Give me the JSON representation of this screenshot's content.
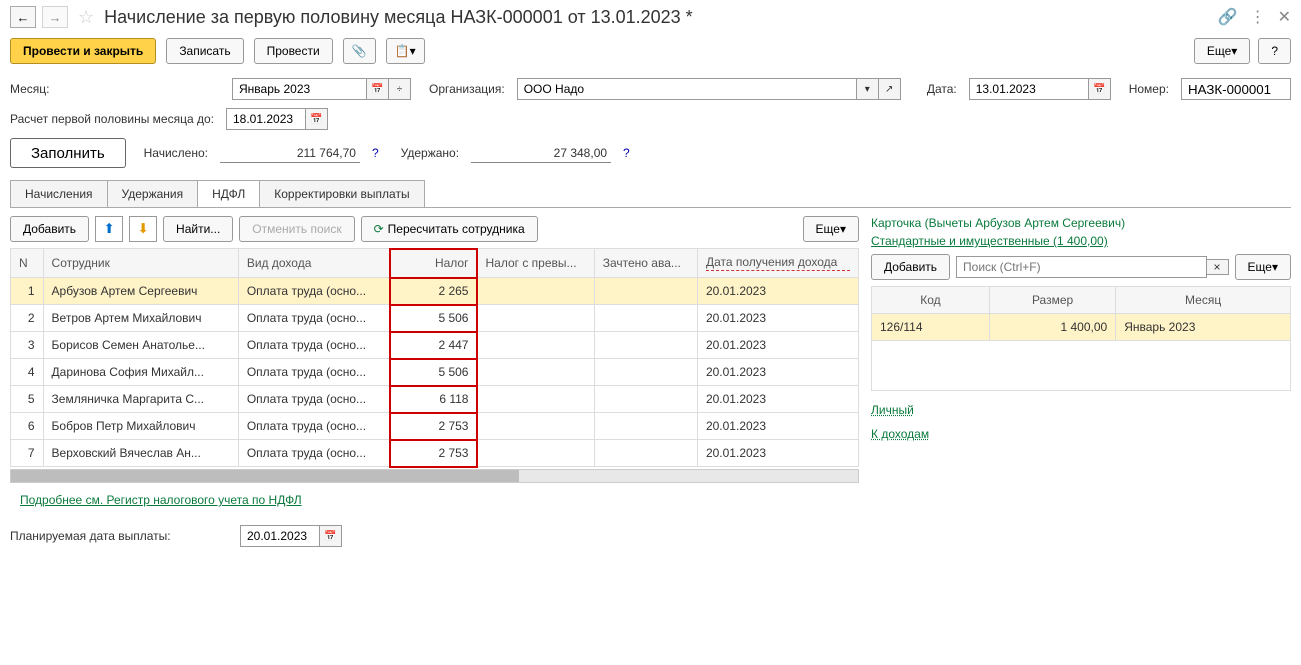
{
  "title": "Начисление за первую половину месяца НАЗК-000001 от 13.01.2023 *",
  "toolbar": {
    "post_close": "Провести и закрыть",
    "write": "Записать",
    "post": "Провести",
    "more": "Еще",
    "help": "?"
  },
  "form": {
    "month_label": "Месяц:",
    "month_value": "Январь 2023",
    "org_label": "Организация:",
    "org_value": "ООО Надо",
    "date_label": "Дата:",
    "date_value": "13.01.2023",
    "number_label": "Номер:",
    "number_value": "НАЗК-000001",
    "calc_until_label": "Расчет первой половины месяца до:",
    "calc_until_value": "18.01.2023",
    "fill": "Заполнить",
    "accrued_label": "Начислено:",
    "accrued_value": "211 764,70",
    "withheld_label": "Удержано:",
    "withheld_value": "27 348,00"
  },
  "tabs": [
    "Начисления",
    "Удержания",
    "НДФЛ",
    "Корректировки выплаты"
  ],
  "table_toolbar": {
    "add": "Добавить",
    "find": "Найти...",
    "cancel_search": "Отменить поиск",
    "recalc": "Пересчитать сотрудника",
    "more": "Еще"
  },
  "columns": {
    "n": "N",
    "employee": "Сотрудник",
    "income_type": "Вид дохода",
    "tax": "Налог",
    "tax_excess": "Налог с превы...",
    "credited": "Зачтено ава...",
    "income_date": "Дата получения дохода"
  },
  "rows": [
    {
      "n": "1",
      "employee": "Арбузов Артем Сергеевич",
      "income_type": "Оплата труда (осно...",
      "tax": "2 265",
      "income_date": "20.01.2023"
    },
    {
      "n": "2",
      "employee": "Ветров Артем Михайлович",
      "income_type": "Оплата труда (осно...",
      "tax": "5 506",
      "income_date": "20.01.2023"
    },
    {
      "n": "3",
      "employee": "Борисов Семен Анатолье...",
      "income_type": "Оплата труда (осно...",
      "tax": "2 447",
      "income_date": "20.01.2023"
    },
    {
      "n": "4",
      "employee": "Даринова София Михайл...",
      "income_type": "Оплата труда (осно...",
      "tax": "5 506",
      "income_date": "20.01.2023"
    },
    {
      "n": "5",
      "employee": "Земляничка Маргарита С...",
      "income_type": "Оплата труда (осно...",
      "tax": "6 118",
      "income_date": "20.01.2023"
    },
    {
      "n": "6",
      "employee": "Бобров Петр Михайлович",
      "income_type": "Оплата труда (осно...",
      "tax": "2 753",
      "income_date": "20.01.2023"
    },
    {
      "n": "7",
      "employee": "Верховский Вячеслав Ан...",
      "income_type": "Оплата труда (осно...",
      "tax": "2 753",
      "income_date": "20.01.2023"
    }
  ],
  "right": {
    "card_title": "Карточка (Вычеты Арбузов Артем Сергеевич)",
    "std_link": "Стандартные и имущественные (1 400,00)",
    "add": "Добавить",
    "search_ph": "Поиск (Ctrl+F)",
    "more": "Еще",
    "cols": {
      "code": "Код",
      "size": "Размер",
      "month": "Месяц"
    },
    "row": {
      "code": "126/114",
      "size": "1 400,00",
      "month": "Январь 2023"
    },
    "personal": "Личный",
    "to_income": "К доходам"
  },
  "footer": {
    "details_link": "Подробнее см. Регистр налогового учета по НДФЛ",
    "planned_date_label": "Планируемая дата выплаты:",
    "planned_date_value": "20.01.2023"
  }
}
